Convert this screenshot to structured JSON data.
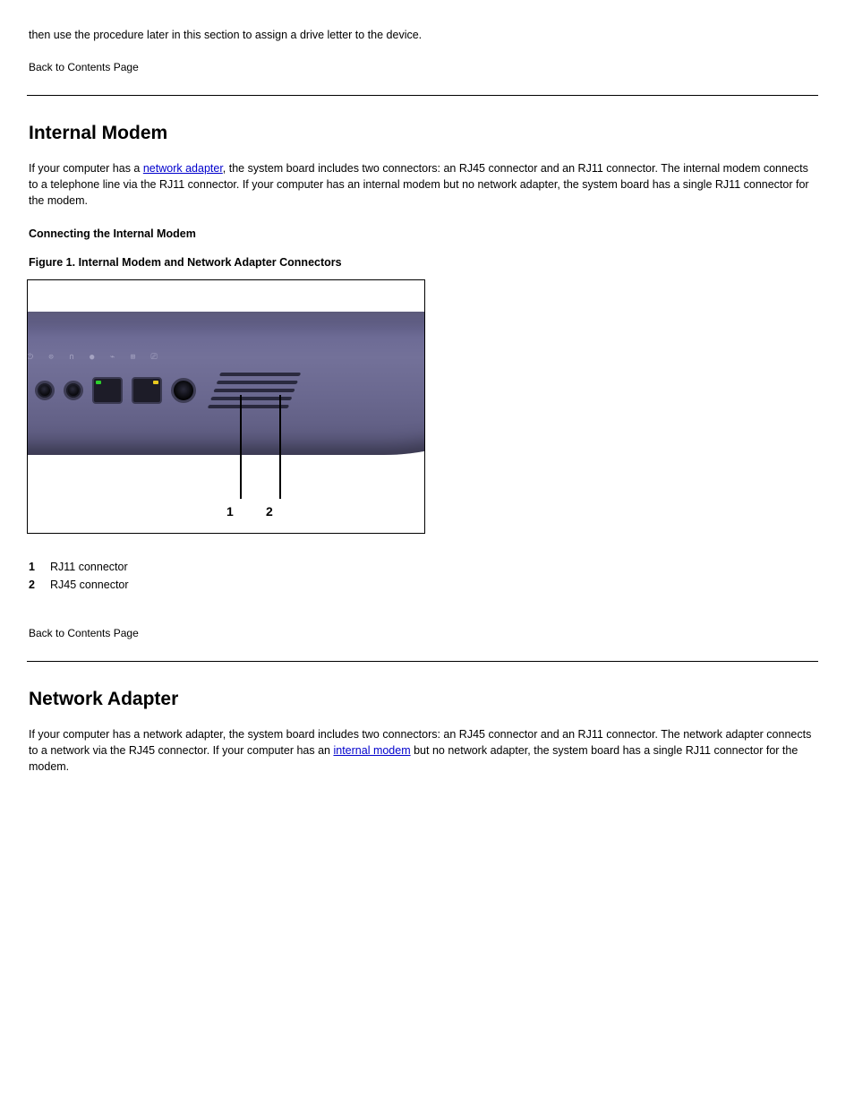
{
  "intro": {
    "paragraph": "then use the procedure later in this section to assign a drive letter to the device."
  },
  "section1": {
    "back_link": "Back to Contents Page",
    "title": "Internal Modem",
    "body_pre": "If your computer has a ",
    "link_text": "network adapter",
    "body_post": ", the system board includes two connectors: an RJ45 connector and an RJ11 connector. The internal modem connects to a telephone line via the RJ11 connector. If your computer has an internal modem but no network adapter, the system board has a single RJ11 connector for the modem.",
    "sub_heading": "Connecting the Internal Modem",
    "figure_caption": "Figure 1. Internal Modem and Network Adapter Connectors",
    "legend": [
      {
        "num": "1",
        "text": "RJ11 connector"
      },
      {
        "num": "2",
        "text": "RJ45 connector"
      }
    ]
  },
  "section2": {
    "back_link": "Back to Contents Page",
    "title": "Network Adapter",
    "body_pre": "If your computer has a network adapter, the system board includes two connectors: an RJ45 connector and an RJ11 connector. The network adapter connects to a network via the RJ45 connector. If your computer has an ",
    "link_text": "internal modem",
    "body_post": " but no network adapter, the system board has a single RJ11 connector for the modem."
  }
}
